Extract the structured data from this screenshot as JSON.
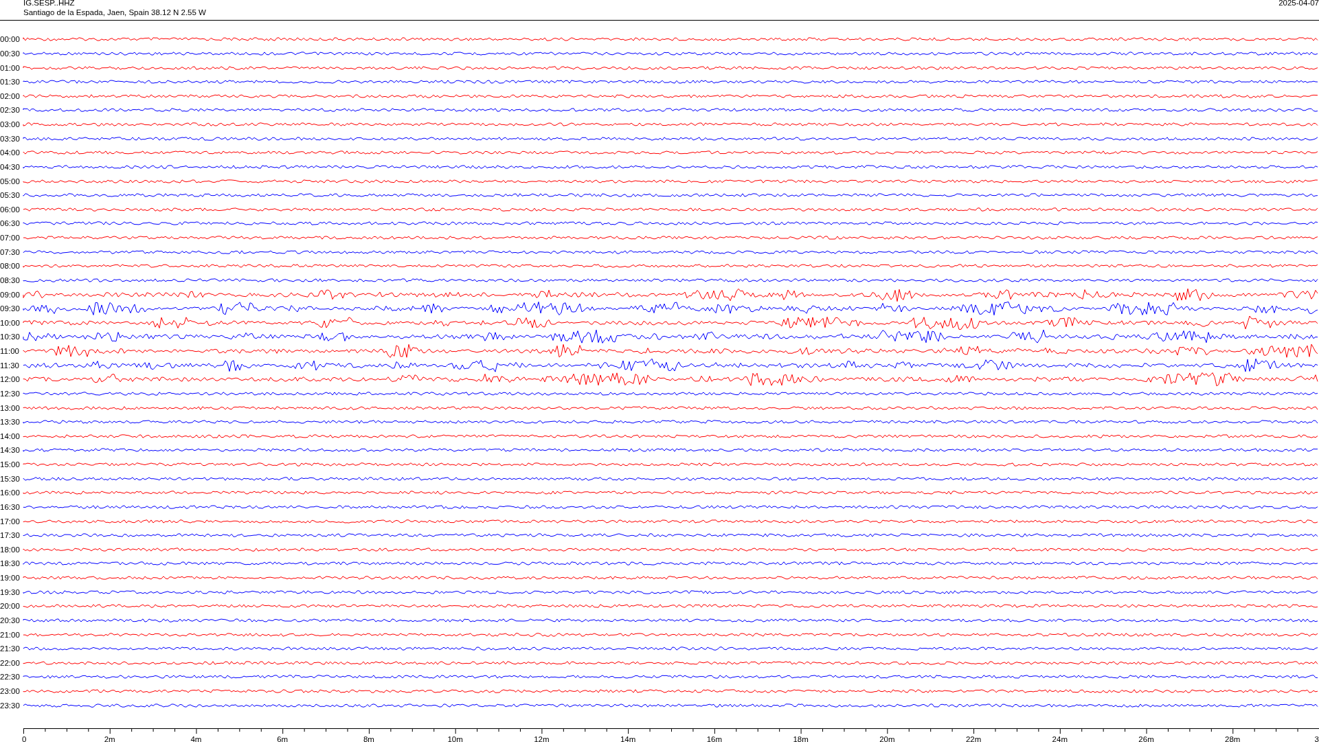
{
  "header": {
    "station": "IG.SESP..HHZ",
    "location": "Santiago de la Espada, Jaen, Spain  38.12 N 2.55 W",
    "date": "2025-04-07"
  },
  "rows": [
    {
      "label": "00:00",
      "color": "#ff0000"
    },
    {
      "label": "00:30",
      "color": "#0000ff"
    },
    {
      "label": "01:00",
      "color": "#ff0000"
    },
    {
      "label": "01:30",
      "color": "#0000ff"
    },
    {
      "label": "02:00",
      "color": "#ff0000"
    },
    {
      "label": "02:30",
      "color": "#0000ff"
    },
    {
      "label": "03:00",
      "color": "#ff0000"
    },
    {
      "label": "03:30",
      "color": "#0000ff"
    },
    {
      "label": "04:00",
      "color": "#ff0000"
    },
    {
      "label": "04:30",
      "color": "#0000ff"
    },
    {
      "label": "05:00",
      "color": "#ff0000"
    },
    {
      "label": "05:30",
      "color": "#0000ff"
    },
    {
      "label": "06:00",
      "color": "#ff0000"
    },
    {
      "label": "06:30",
      "color": "#0000ff"
    },
    {
      "label": "07:00",
      "color": "#ff0000"
    },
    {
      "label": "07:30",
      "color": "#0000ff"
    },
    {
      "label": "08:00",
      "color": "#ff0000"
    },
    {
      "label": "08:30",
      "color": "#0000ff"
    },
    {
      "label": "09:00",
      "color": "#ff0000"
    },
    {
      "label": "09:30",
      "color": "#0000ff"
    },
    {
      "label": "10:00",
      "color": "#ff0000"
    },
    {
      "label": "10:30",
      "color": "#0000ff"
    },
    {
      "label": "11:00",
      "color": "#ff0000"
    },
    {
      "label": "11:30",
      "color": "#0000ff"
    },
    {
      "label": "12:00",
      "color": "#ff0000"
    },
    {
      "label": "12:30",
      "color": "#0000ff"
    },
    {
      "label": "13:00",
      "color": "#ff0000"
    },
    {
      "label": "13:30",
      "color": "#0000ff"
    },
    {
      "label": "14:00",
      "color": "#ff0000"
    },
    {
      "label": "14:30",
      "color": "#0000ff"
    },
    {
      "label": "15:00",
      "color": "#ff0000"
    },
    {
      "label": "15:30",
      "color": "#0000ff"
    },
    {
      "label": "16:00",
      "color": "#ff0000"
    },
    {
      "label": "16:30",
      "color": "#0000ff"
    },
    {
      "label": "17:00",
      "color": "#ff0000"
    },
    {
      "label": "17:30",
      "color": "#0000ff"
    },
    {
      "label": "18:00",
      "color": "#ff0000"
    },
    {
      "label": "18:30",
      "color": "#0000ff"
    },
    {
      "label": "19:00",
      "color": "#ff0000"
    },
    {
      "label": "19:30",
      "color": "#0000ff"
    },
    {
      "label": "20:00",
      "color": "#ff0000"
    },
    {
      "label": "20:30",
      "color": "#0000ff"
    },
    {
      "label": "21:00",
      "color": "#ff0000"
    },
    {
      "label": "21:30",
      "color": "#0000ff"
    },
    {
      "label": "22:00",
      "color": "#ff0000"
    },
    {
      "label": "22:30",
      "color": "#0000ff"
    },
    {
      "label": "23:00",
      "color": "#ff0000"
    },
    {
      "label": "23:30",
      "color": "#0000ff"
    }
  ],
  "x_axis": {
    "tick_labels": [
      "0",
      "2m",
      "4m",
      "6m",
      "8m",
      "10m",
      "12m",
      "14m",
      "16m",
      "18m",
      "20m",
      "22m",
      "24m",
      "26m",
      "28m",
      "3"
    ]
  }
}
